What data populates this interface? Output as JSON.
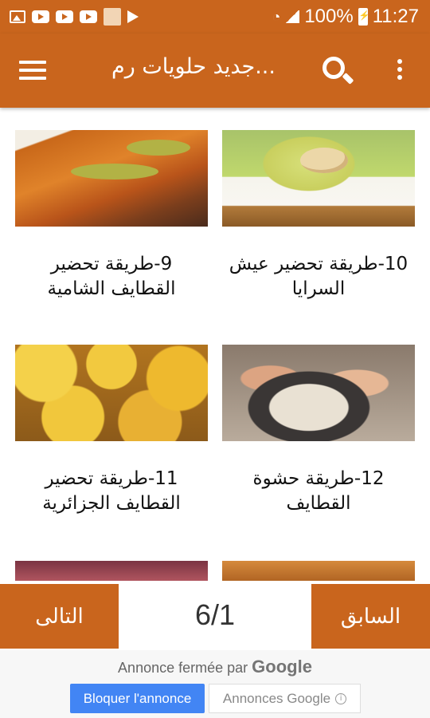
{
  "status_bar": {
    "battery": "100%",
    "time": "11:27",
    "icons": [
      "image-icon",
      "youtube-icon",
      "youtube-icon",
      "youtube-icon",
      "avatar-icon",
      "play-store-icon",
      "wifi-icon",
      "signal-icon",
      "battery-icon"
    ]
  },
  "app_bar": {
    "title": "جديد حلويات رم...",
    "icons": [
      "menu-icon",
      "search-icon",
      "more-vert-icon"
    ]
  },
  "recipes": [
    {
      "caption": "10-طريقة تحضير عيش السرايا"
    },
    {
      "caption": "9-طريقة تحضير القطايف الشامية"
    },
    {
      "caption": "12-طريقة حشوة القطايف"
    },
    {
      "caption": "11-طريقة تحضير القطايف الجزائرية"
    }
  ],
  "pager": {
    "next_label": "التالى",
    "prev_label": "السابق",
    "page_counter": "6/1"
  },
  "ad": {
    "closed_text": "Annonce fermée par",
    "closed_brand": "Google",
    "block_label": "Bloquer l'annonce",
    "ads_label": "Annonces Google",
    "info_symbol": "i"
  },
  "colors": {
    "primary": "#c9651d",
    "ad_button": "#4285f4"
  }
}
